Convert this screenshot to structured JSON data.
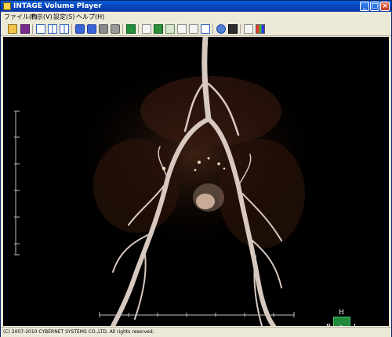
{
  "window": {
    "title": "INTAGE Volume Player",
    "controls": [
      "_",
      "□",
      "×"
    ]
  },
  "menubar": {
    "items": [
      "ファイル(F)",
      "表示(V)",
      "設定(S)",
      "ヘルプ(H)"
    ]
  },
  "toolbar": {
    "buttons": [
      {
        "name": "open-folder",
        "icon": "folder-icon"
      },
      {
        "name": "save",
        "icon": "disk-icon"
      },
      {
        "name": "layout-single",
        "icon": "layout-single-icon"
      },
      {
        "name": "layout-split-vertical",
        "icon": "layout-split-vertical-icon"
      },
      {
        "name": "layout-quad",
        "icon": "layout-quad-icon"
      },
      {
        "name": "cube-front",
        "icon": "cube-icon"
      },
      {
        "name": "cube-side",
        "icon": "cube-icon"
      },
      {
        "name": "cube-top",
        "icon": "cube-icon"
      },
      {
        "name": "cube-gray",
        "icon": "cube-icon"
      },
      {
        "name": "green-box",
        "icon": "green-box-icon"
      },
      {
        "name": "image-export",
        "icon": "image-icon"
      },
      {
        "name": "mesh",
        "icon": "mesh-icon"
      },
      {
        "name": "rotate",
        "icon": "rotate-icon"
      },
      {
        "name": "crosshair",
        "icon": "crosshair-icon"
      },
      {
        "name": "annotation",
        "icon": "text-box-icon"
      },
      {
        "name": "panel",
        "icon": "panel-icon"
      },
      {
        "name": "camera",
        "icon": "camera-icon"
      },
      {
        "name": "person",
        "icon": "person-icon"
      },
      {
        "name": "window-frame",
        "icon": "window-frame-icon"
      },
      {
        "name": "color-table",
        "icon": "color-table-icon"
      }
    ]
  },
  "viewport": {
    "orientation": {
      "top": "H",
      "left": "R",
      "right": "L",
      "center": "A"
    },
    "orientation_color": "#1f8a3c"
  },
  "statusbar": {
    "text": "(C) 2007-2010 CYBERNET SYSTEMS CO.,LTD. All rights reserved."
  }
}
